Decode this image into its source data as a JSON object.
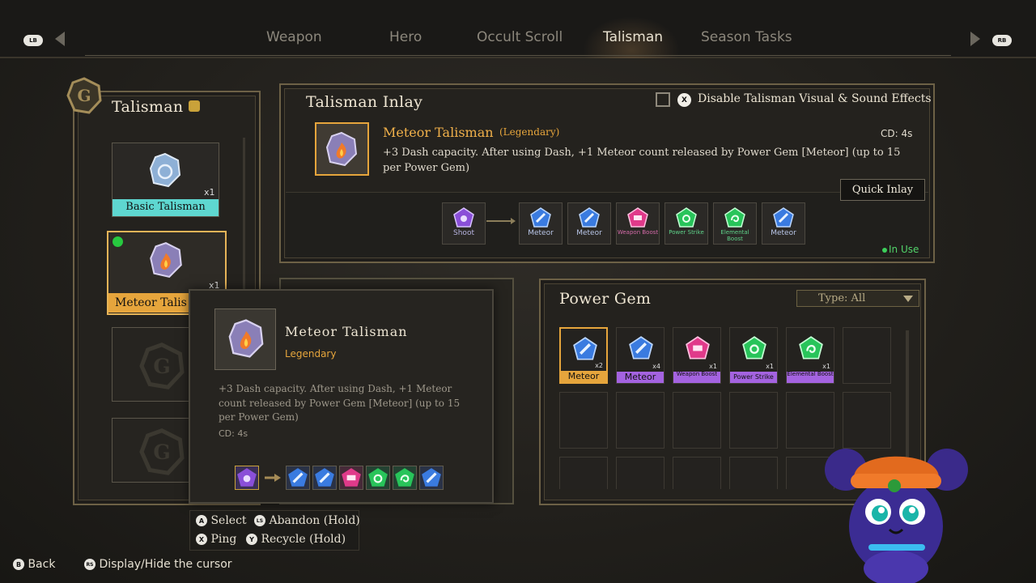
{
  "nav": {
    "left_button": "LB",
    "right_button": "RB",
    "tabs": [
      "Weapon",
      "Hero",
      "Occult Scroll",
      "Talisman",
      "Season Tasks"
    ],
    "active_tab": "Talisman"
  },
  "talisman_list": {
    "title": "Talisman",
    "items": [
      {
        "label": "Basic Talisman",
        "count": "x1"
      },
      {
        "label": "Meteor Talis",
        "count": "x1"
      }
    ]
  },
  "inlay": {
    "title": "Talisman Inlay",
    "toggle_button_glyph": "X",
    "toggle_label": "Disable Talisman Visual & Sound Effects",
    "name": "Meteor Talisman",
    "rarity": "(Legendary)",
    "cd": "CD:  4s",
    "description": "+3 Dash capacity. After using Dash, +1 Meteor count released by Power Gem [Meteor] (up to 15 per Power Gem)",
    "quick_inlay": "Quick Inlay",
    "chain": [
      {
        "name": "Shoot",
        "color": "#8a4fd8"
      },
      {
        "name": "Meteor",
        "color": "#3a7be0"
      },
      {
        "name": "Meteor",
        "color": "#3a7be0"
      },
      {
        "name": "Weapon Boost",
        "color": "#e03a8a"
      },
      {
        "name": "Power Strike",
        "color": "#28c45a"
      },
      {
        "name": "Elemental Boost",
        "color": "#28c45a"
      },
      {
        "name": "Meteor",
        "color": "#3a7be0"
      }
    ],
    "status": "In Use"
  },
  "tooltip": {
    "name": "Meteor Talisman",
    "rarity": "Legendary",
    "description": "+3 Dash capacity. After using Dash, +1 Meteor count released by Power Gem [Meteor] (up to 15 per Power Gem)",
    "cd": "CD:  4s"
  },
  "power_gem": {
    "title": "Power Gem",
    "filter": "Type: All",
    "gems": [
      {
        "label": "Meteor",
        "count": "x2",
        "label_color": "#e6a53c",
        "color": "#3a7be0"
      },
      {
        "label": "Meteor",
        "count": "x4",
        "label_color": "#a463e0",
        "color": "#3a7be0"
      },
      {
        "label": "Weapon Boost",
        "count": "x1",
        "label_color": "#a463e0",
        "color": "#e03a8a"
      },
      {
        "label": "Power Strike",
        "count": "x1",
        "label_color": "#a463e0",
        "color": "#28c45a"
      },
      {
        "label": "Elemental Boost",
        "count": "x1",
        "label_color": "#a463e0",
        "color": "#28c45a"
      }
    ]
  },
  "controls": {
    "select_glyph": "A",
    "select": "Select",
    "abandon_glyph": "LS",
    "abandon": "Abandon (Hold)",
    "ping_glyph": "X",
    "ping": "Ping",
    "recycle_glyph": "Y",
    "recycle": "Recycle (Hold)",
    "back_glyph": "B",
    "back": "Back",
    "cursor_glyph": "RS",
    "cursor": "Display/Hide the cursor"
  }
}
